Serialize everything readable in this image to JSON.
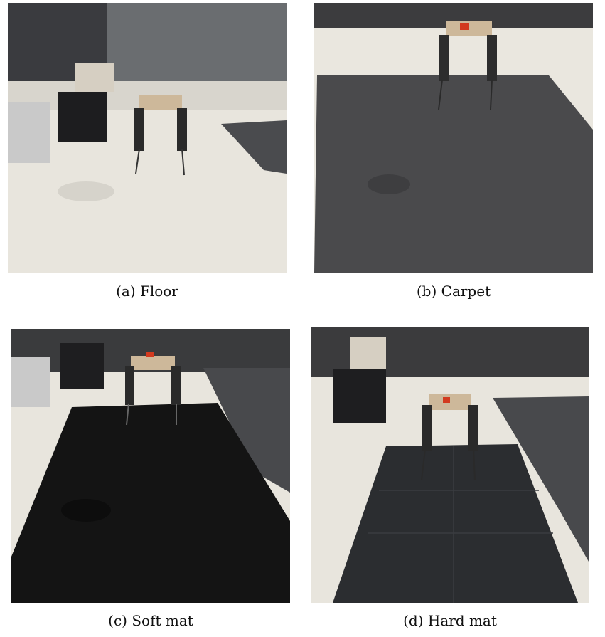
{
  "figure": {
    "panels": [
      {
        "caption": "(a) Floor",
        "surface_color": "#e9e6de"
      },
      {
        "caption": "(b) Carpet",
        "surface_color": "#4a4a4c"
      },
      {
        "caption": "(c) Soft mat",
        "surface_color": "#141414"
      },
      {
        "caption": "(d) Hard mat",
        "surface_color": "#2b2d30"
      }
    ]
  }
}
